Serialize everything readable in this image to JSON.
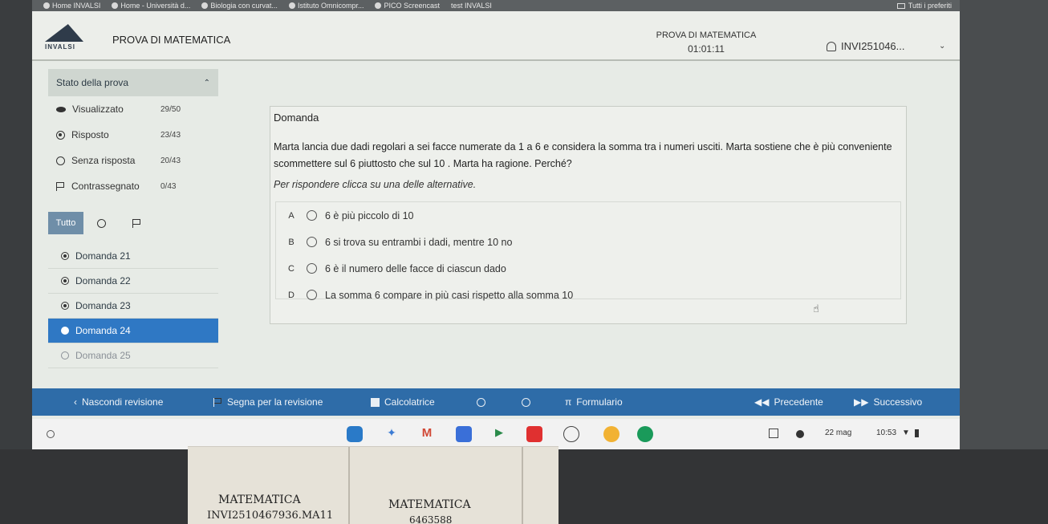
{
  "bookmarks": {
    "items": [
      "Home INVALSI",
      "Home - Università d...",
      "Biologia con curvat...",
      "Istituto Omnicompr...",
      "PICO Screencast",
      "test INVALSI"
    ],
    "all_favorites": "Tutti i preferiti"
  },
  "header": {
    "logo_text": "INVALSI",
    "app_title": "PROVA DI MATEMATICA",
    "center_title": "PROVA DI MATEMATICA",
    "timer": "01:01:11",
    "user_id": "INVI251046..."
  },
  "sidebar": {
    "status_title": "Stato della prova",
    "stats": [
      {
        "label": "Visualizzato",
        "value": "29/50"
      },
      {
        "label": "Risposto",
        "value": "23/43"
      },
      {
        "label": "Senza risposta",
        "value": "20/43"
      },
      {
        "label": "Contrassegnato",
        "value": "0/43"
      }
    ],
    "filter_all": "Tutto",
    "questions": [
      {
        "label": "Domanda 21"
      },
      {
        "label": "Domanda 22"
      },
      {
        "label": "Domanda 23"
      },
      {
        "label": "Domanda 24"
      },
      {
        "label": "Domanda 25"
      }
    ]
  },
  "question": {
    "heading": "Domanda",
    "text": "Marta lancia due dadi regolari a sei facce numerate da 1 a 6 e considera la somma tra i numeri usciti. Marta sostiene che è più conveniente scommettere sul 6 piuttosto che sul 10 . Marta ha ragione. Perché?",
    "instruction": "Per rispondere clicca su una delle alternative.",
    "answers": [
      {
        "letter": "A",
        "text": "6 è più piccolo di 10"
      },
      {
        "letter": "B",
        "text": "6 si trova su entrambi i dadi, mentre 10 no"
      },
      {
        "letter": "C",
        "text": "6 è il numero delle facce di ciascun dado"
      },
      {
        "letter": "D",
        "text": "La somma 6 compare in più casi rispetto alla somma 10"
      }
    ]
  },
  "toolbar": {
    "hide_review": "Nascondi revisione",
    "mark_review": "Segna per la revisione",
    "calculator": "Calcolatrice",
    "formulas": "Formulario",
    "previous": "Precedente",
    "next": "Successivo"
  },
  "taskbar": {
    "date": "22 mag",
    "time": "10:53"
  },
  "paper_labels": {
    "left_subject": "MATEMATICA",
    "left_code": "INVI2510467936.MA11",
    "right_subject": "MATEMATICA",
    "right_code": "6463588"
  },
  "colors": {
    "toolbar_blue": "#2e6ca8",
    "active_item_blue": "#2f78c4",
    "filter_blue": "#6f8ea8"
  }
}
